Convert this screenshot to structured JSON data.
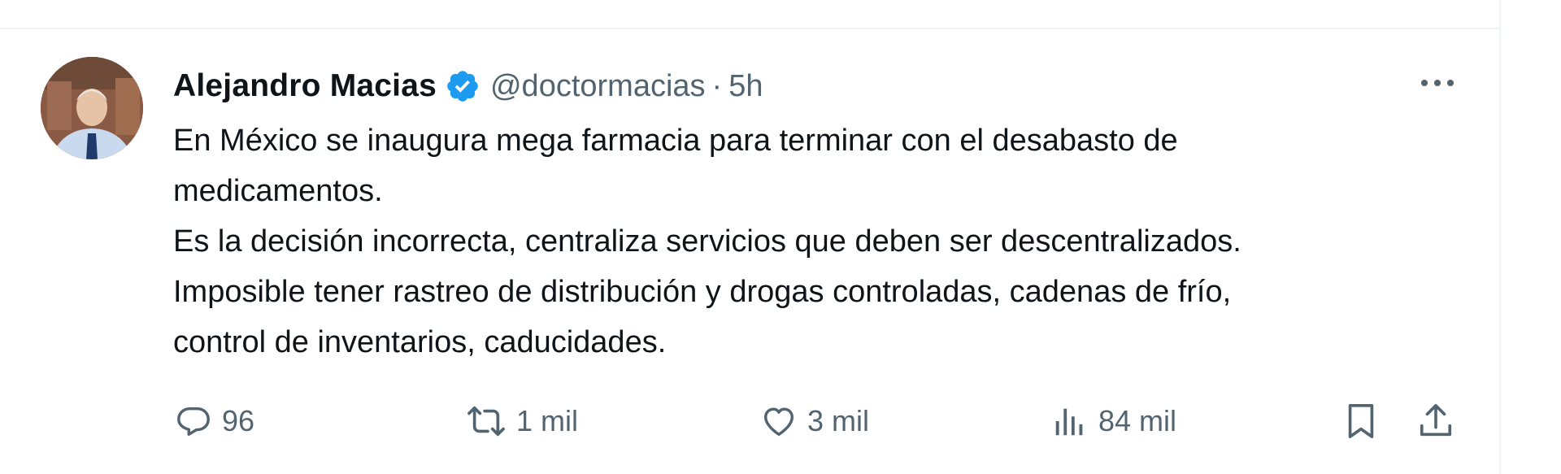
{
  "tweet": {
    "display_name": "Alejandro Macias",
    "handle": "@doctormacias",
    "separator": "·",
    "time": "5h",
    "text_lines": [
      "En México se inaugura mega farmacia para terminar con el desabasto de",
      "medicamentos.",
      "Es la decisión incorrecta, centraliza servicios que deben ser descentralizados.",
      "Imposible tener rastreo de distribución y drogas controladas, cadenas de frío,",
      "control de inventarios, caducidades."
    ]
  },
  "actions": {
    "replies": "96",
    "retweets": "1 mil",
    "likes": "3 mil",
    "views": "84 mil"
  },
  "icons": {
    "verified": "verified-badge-icon",
    "more": "more-options-icon",
    "reply": "reply-icon",
    "retweet": "retweet-icon",
    "like": "heart-icon",
    "views": "views-icon",
    "bookmark": "bookmark-icon",
    "share": "share-icon"
  },
  "colors": {
    "text_primary": "#0f1419",
    "text_secondary": "#536471",
    "verified_blue": "#1d9bf0",
    "divider": "#eff3f4"
  }
}
